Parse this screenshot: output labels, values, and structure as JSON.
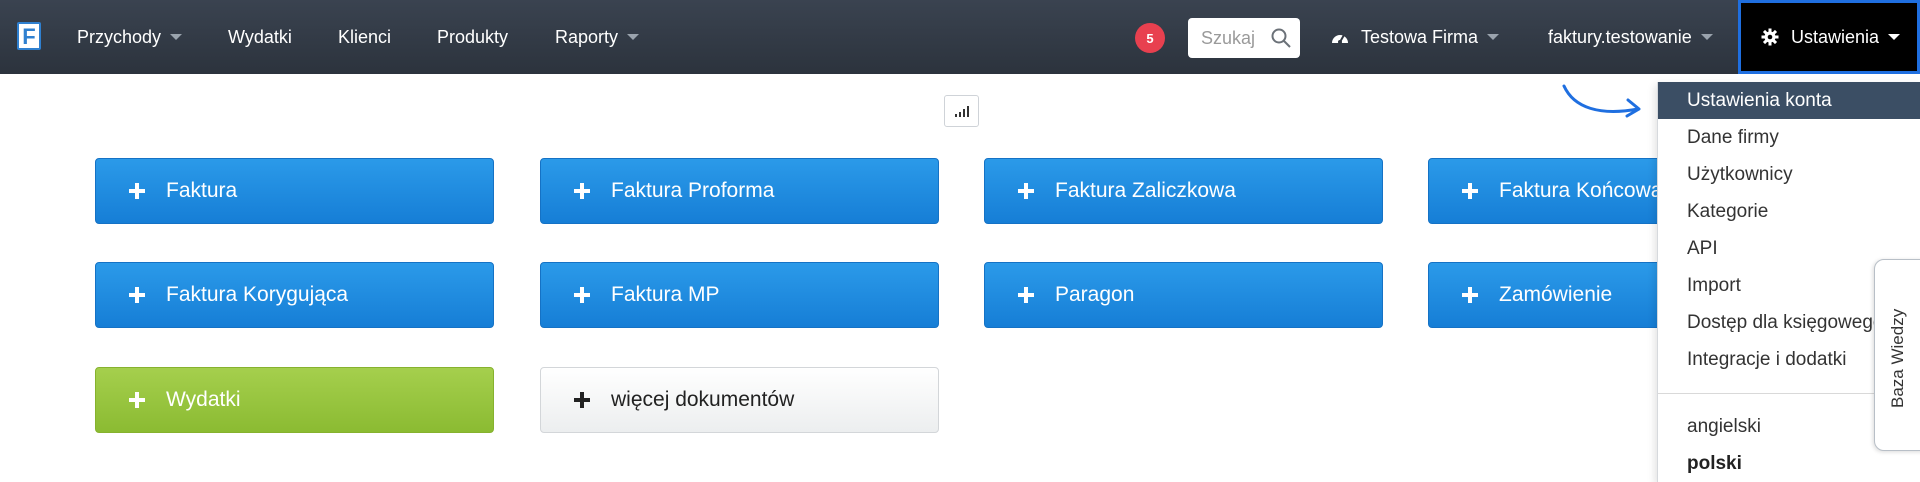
{
  "navbar": {
    "logo": "F",
    "items": [
      {
        "label": "Przychody",
        "dropdown": true
      },
      {
        "label": "Wydatki",
        "dropdown": false
      },
      {
        "label": "Klienci",
        "dropdown": false
      },
      {
        "label": "Produkty",
        "dropdown": false
      },
      {
        "label": "Raporty",
        "dropdown": true
      }
    ],
    "notification_count": "5",
    "search_placeholder": "Szukaj",
    "company": "Testowa Firma",
    "account": "faktury.testowanie",
    "settings": "Ustawienia"
  },
  "documents": {
    "row1": [
      "Faktura",
      "Faktura Proforma",
      "Faktura Zaliczkowa",
      "Faktura Końcowa"
    ],
    "row2": [
      "Faktura Korygująca",
      "Faktura MP",
      "Paragon",
      "Zamówienie"
    ],
    "expenses": "Wydatki",
    "more": "więcej dokumentów"
  },
  "settings_menu": {
    "items": [
      "Ustawienia konta",
      "Dane firmy",
      "Użytkownicy",
      "Kategorie",
      "API",
      "Import",
      "Dostęp dla księgowego",
      "Integracje i dodatki"
    ],
    "active_index": 0,
    "languages": [
      "angielski",
      "polski"
    ],
    "current_language": "polski"
  },
  "knowledge_base_tab": "Baza Wiedzy",
  "colors": {
    "navbar": "#2f3640",
    "primary_button": "#1c87dc",
    "expense_button": "#97c43e",
    "notification_badge": "#e8404f",
    "settings_highlight": "#1f6fe0",
    "menu_active": "#3b4e64"
  }
}
